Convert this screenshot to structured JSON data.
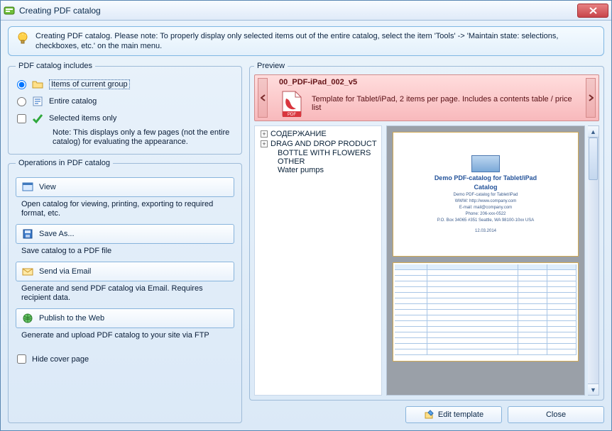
{
  "window": {
    "title": "Creating PDF catalog"
  },
  "note": "Creating PDF catalog. Please note: To properly display only selected items out of the entire catalog, select the item  'Tools' -> 'Maintain state: selections, checkboxes, etc.' on the main menu.",
  "includes": {
    "legend": "PDF catalog includes",
    "opt_current": "Items of current group",
    "opt_entire": "Entire catalog",
    "opt_selected": "Selected items only",
    "note": "Note: This displays only a few pages (not the entire catalog) for evaluating the appearance.",
    "selected_option": "current",
    "selected_only_checked": false
  },
  "ops": {
    "legend": "Operations in PDF catalog",
    "view": {
      "label": "View",
      "desc": "Open catalog for viewing, printing, exporting to required format, etc."
    },
    "save": {
      "label": "Save As...",
      "desc": "Save catalog to a PDF file"
    },
    "email": {
      "label": "Send via Email",
      "desc": "Generate and send PDF catalog via Email. Requires recipient data."
    },
    "web": {
      "label": "Publish to the Web",
      "desc": "Generate and upload PDF catalog to your site via FTP"
    },
    "hide_cover": {
      "label": "Hide cover page",
      "checked": false
    }
  },
  "preview": {
    "legend": "Preview",
    "template": {
      "name": "00_PDF-iPad_002_v5",
      "desc": "Template for Tablet/iPad, 2 items per page. Includes a contents table / price list",
      "badge": "PDF"
    },
    "tree": [
      {
        "label": "СОДЕРЖАНИЕ",
        "expandable": true
      },
      {
        "label": "DRAG AND DROP PRODUCT",
        "expandable": true
      },
      {
        "label": "BOTTLE WITH FLOWERS"
      },
      {
        "label": "OTHER"
      },
      {
        "label": "Water pumps"
      }
    ],
    "cover": {
      "title": "Demo PDF-catalog for Tablet/iPad",
      "subtitle": "Catalog",
      "lines": [
        "Demo PDF-catalog for Tablet/iPad",
        "WWW: http://www.company.com",
        "E-mail: mail@company.com",
        "Phone: 206-xxx-0522",
        "P.O. Box 34065 #351 Seattle, WA 98100-10xx USA"
      ],
      "date": "12.03.2014"
    }
  },
  "buttons": {
    "edit": "Edit template",
    "close": "Close"
  }
}
